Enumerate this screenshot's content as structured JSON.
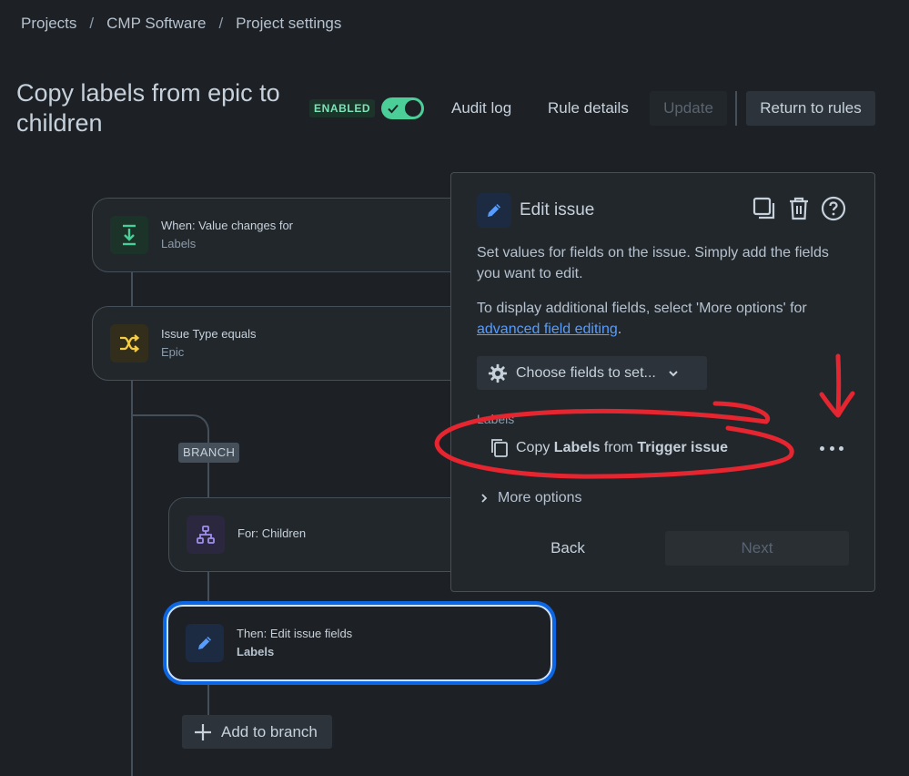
{
  "breadcrumb": {
    "items": [
      "Projects",
      "CMP Software",
      "Project settings"
    ],
    "separator": "/"
  },
  "header": {
    "title": "Copy labels from epic to children",
    "status_badge": "ENABLED",
    "toggle_on": true,
    "audit_log": "Audit log",
    "rule_details": "Rule details",
    "update": "Update",
    "return_to_rules": "Return to rules"
  },
  "flow": {
    "trigger": {
      "title": "When: Value changes for",
      "subtitle": "Labels",
      "icon": "download-arrow-icon",
      "color": "#4bce97"
    },
    "condition": {
      "title": "Issue Type equals",
      "subtitle": "Epic",
      "icon": "shuffle-icon",
      "color": "#f5cd47"
    },
    "branch_label": "BRANCH",
    "branch": {
      "title": "For: Children",
      "icon": "hierarchy-icon",
      "color": "#9f8fef"
    },
    "action": {
      "title": "Then: Edit issue fields",
      "subtitle": "Labels",
      "icon": "pencil-icon",
      "color": "#579dff"
    },
    "add_to_branch": "Add to branch"
  },
  "panel": {
    "title": "Edit issue",
    "description": "Set values for fields on the issue. Simply add the fields you want to edit.",
    "additional_prefix": "To display additional fields, select 'More options' for ",
    "additional_link": "advanced field editing",
    "additional_suffix": ".",
    "choose_fields": "Choose fields to set...",
    "field_label": "Labels",
    "copy_prefix": "Copy ",
    "copy_field": "Labels",
    "copy_middle": " from ",
    "copy_source": "Trigger issue",
    "more_options": "More options",
    "back": "Back",
    "next": "Next"
  },
  "colors": {
    "background": "#1d2125",
    "accent": "#579dff",
    "enabled": "#4bce97",
    "annotation": "#e5252f"
  }
}
